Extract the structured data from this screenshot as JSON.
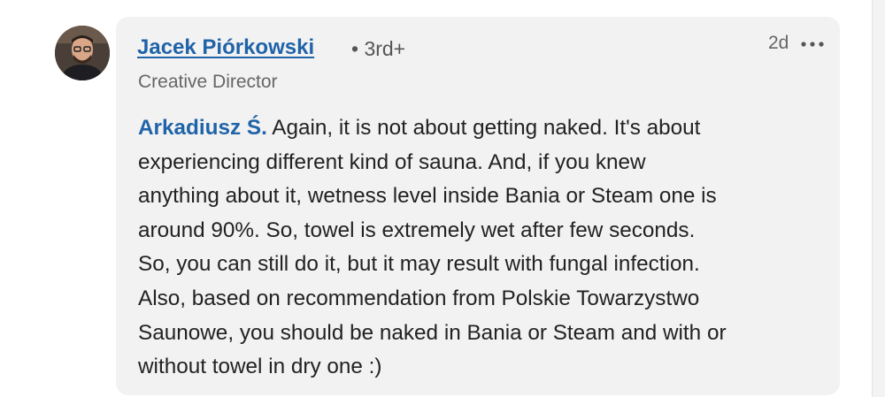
{
  "comment": {
    "author": {
      "name": "Jacek Piórkowski",
      "connection_degree": "• 3rd+",
      "headline": "Creative Director",
      "avatar_icon": "person-avatar-photo"
    },
    "timestamp": "2d",
    "more_icon": "more-horizontal-icon",
    "mention": "Arkadiusz Ś.",
    "text_lines": [
      " Again, it is not about getting naked. It's about",
      "experiencing different kind of sauna. And, if you knew",
      "anything about it, wetness level inside Bania or Steam one is",
      "around 90%. So, towel is extremely wet after few seconds.",
      "So, you can still do it, but it may result with fungal infection.",
      "Also, based on recommendation from Polskie Towarzystwo",
      "Saunowe, you should be naked in Bania or Steam and with or",
      "without towel in dry one :)"
    ]
  },
  "colors": {
    "link_blue": "#1f63a8",
    "bubble_background": "#f2f2f2",
    "body_text": "#222222",
    "secondary_text": "#666666"
  }
}
